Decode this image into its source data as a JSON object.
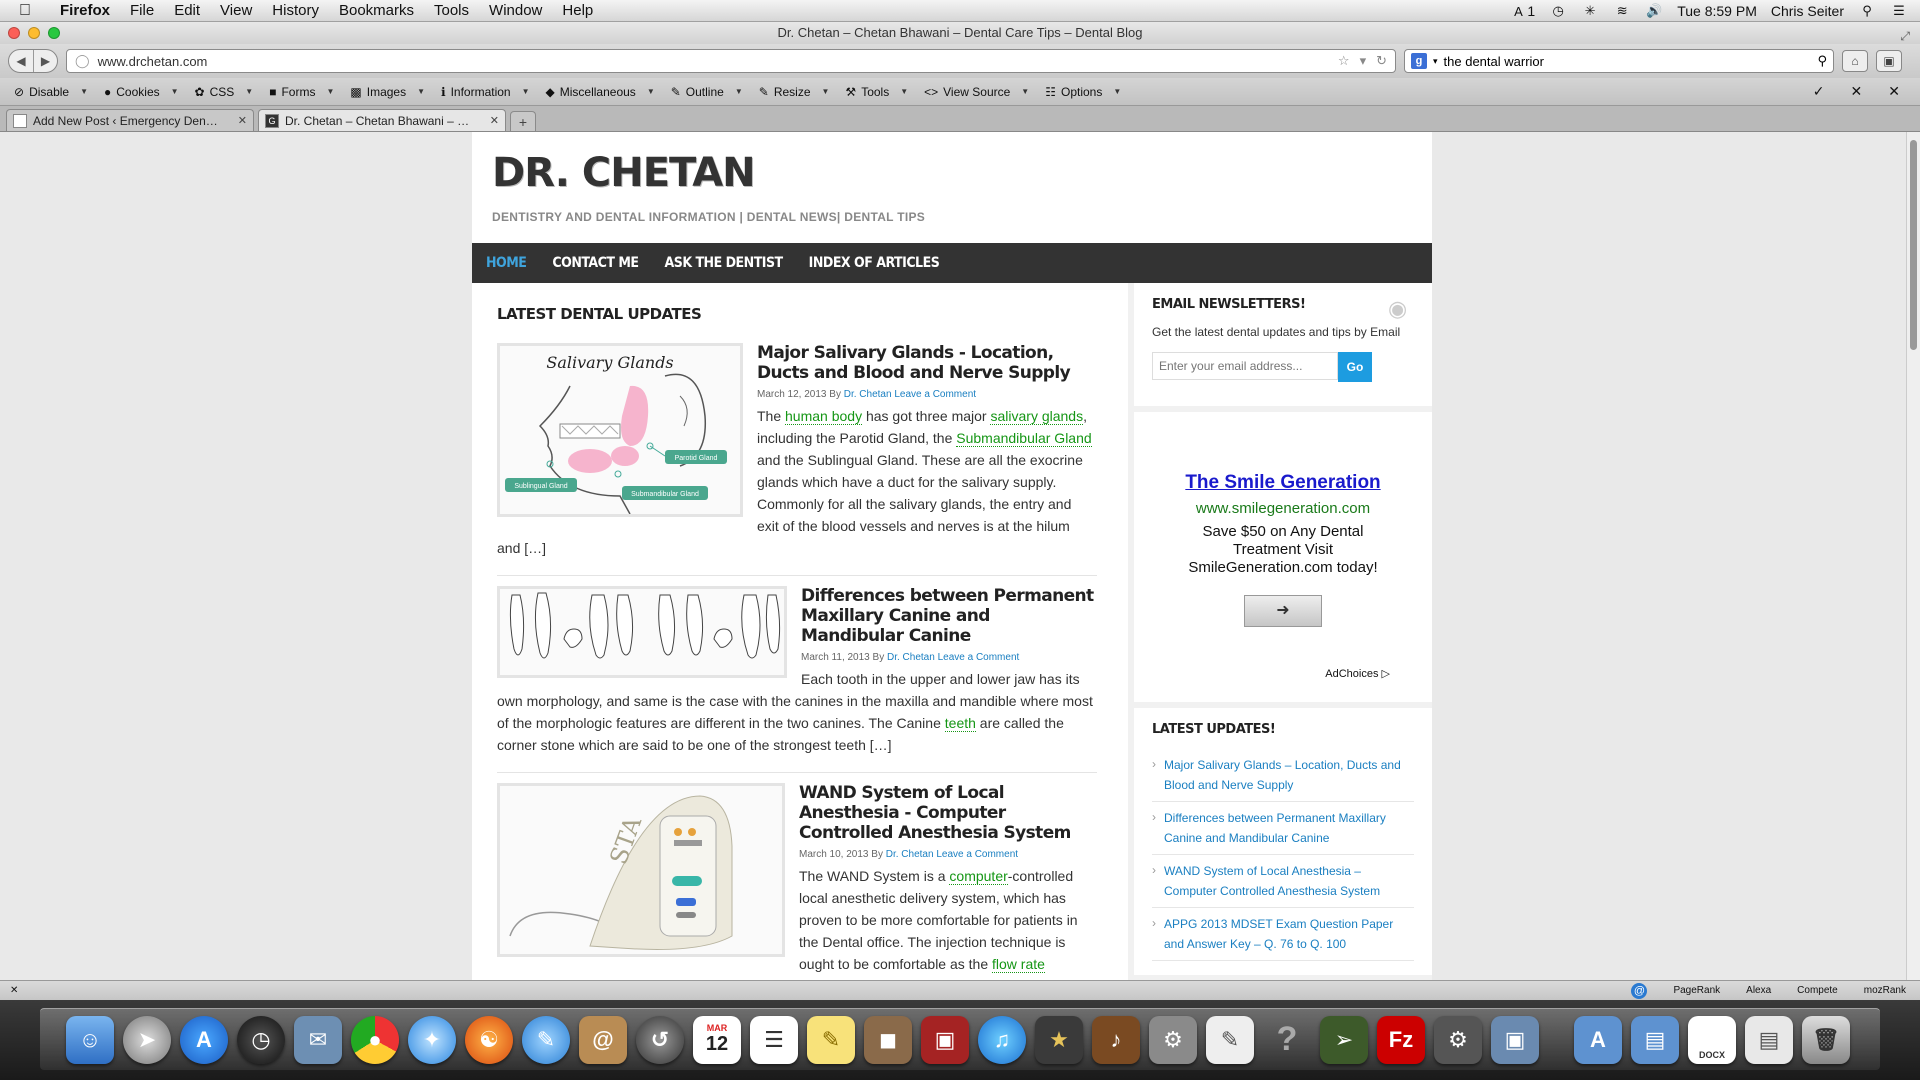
{
  "menubar": {
    "app": "Firefox",
    "items": [
      "File",
      "Edit",
      "View",
      "History",
      "Bookmarks",
      "Tools",
      "Window",
      "Help"
    ],
    "status_badge": "1",
    "clock": "Tue 8:59 PM",
    "user": "Chris Seiter"
  },
  "window": {
    "title": "Dr. Chetan – Chetan Bhawani – Dental Care Tips – Dental Blog"
  },
  "navbar": {
    "url": "www.drchetan.com",
    "search_value": "the dental warrior"
  },
  "devbar": {
    "items": [
      "Disable",
      "Cookies",
      "CSS",
      "Forms",
      "Images",
      "Information",
      "Miscellaneous",
      "Outline",
      "Resize",
      "Tools",
      "View Source",
      "Options"
    ]
  },
  "tabs": [
    {
      "title": "Add New Post ‹ Emergency Den…"
    },
    {
      "title": "Dr. Chetan – Chetan Bhawani – …"
    }
  ],
  "site": {
    "logo": "DR. CHETAN",
    "tagline": "DENTISTRY AND DENTAL INFORMATION | DENTAL NEWS| DENTAL TIPS",
    "nav": [
      "HOME",
      "CONTACT ME",
      "ASK THE DENTIST",
      "INDEX OF ARTICLES"
    ]
  },
  "main": {
    "heading": "LATEST DENTAL UPDATES",
    "posts": [
      {
        "title": "Major Salivary Glands - Location, Ducts and Blood and Nerve Supply",
        "date": "March 12, 2013",
        "by": "By",
        "author": "Dr. Chetan",
        "comment": "Leave a Comment",
        "thumb_title": "Salivary Glands",
        "thumb_labels": [
          "Parotid Gland",
          "Sublingual Gland",
          "Submandibular Gland"
        ],
        "excerpt": {
          "t1": "The ",
          "k1": "human body",
          "t2": " has got three major ",
          "k2": "salivary glands",
          "t3": ", including the Parotid Gland, the ",
          "k3": "Submandibular Gland",
          "t4": " and the Sublingual Gland. These are all the exocrine glands which have a duct for the salivary supply. Commonly for all the salivary glands, the entry and exit of the blood vessels and nerves is at the hilum and […]"
        }
      },
      {
        "title": "Differences between Permanent Maxillary Canine and Mandibular Canine",
        "date": "March 11, 2013",
        "by": "By",
        "author": "Dr. Chetan",
        "comment": "Leave a Comment",
        "excerpt": {
          "t1": "Each tooth in the upper and lower jaw has its own morphology, and same is the case with the canines in the maxilla and mandible where most of the morphologic features are different in the two canines. The Canine ",
          "k1": "teeth",
          "t2": " are called the corner stone which are said to be one of the strongest teeth […]"
        }
      },
      {
        "title": "WAND System of Local Anesthesia - Computer Controlled Anesthesia System",
        "date": "March 10, 2013",
        "by": "By",
        "author": "Dr. Chetan",
        "comment": "Leave a Comment",
        "thumb_label": "STA",
        "excerpt": {
          "t1": "The WAND System is a ",
          "k1": "computer",
          "t2": "-controlled local anesthetic delivery system, which has proven to be more comfortable for patients in the Dental office. The injection technique is ought to be comfortable as the ",
          "k2": "flow rate"
        }
      }
    ]
  },
  "sidebar": {
    "newsletter": {
      "title": "EMAIL NEWSLETTERS!",
      "text": "Get the latest dental updates and tips by Email",
      "placeholder": "Enter your email address...",
      "button": "Go"
    },
    "ad": {
      "title": "The Smile Generation",
      "url": "www.smilegeneration.com",
      "text": "Save $50 on Any Dental Treatment Visit SmileGeneration.com today!",
      "choices": "AdChoices"
    },
    "updates": {
      "title": "LATEST UPDATES!",
      "items": [
        "Major Salivary Glands – Location, Ducts and Blood and Nerve Supply",
        "Differences between Permanent Maxillary Canine and Mandibular Canine",
        "WAND System of Local Anesthesia – Computer Controlled Anesthesia System",
        "APPG 2013 MDSET Exam Question Paper and Answer Key – Q. 76 to Q. 100"
      ]
    }
  },
  "statusbar": {
    "items": [
      "PageRank",
      "Alexa",
      "Compete",
      "mozRank"
    ]
  },
  "dock": {
    "calendar_month": "MAR",
    "calendar_day": "12",
    "docx_label": "DOCX"
  },
  "colors": {
    "accent": "#1d9ce0",
    "nav_bg": "#333333",
    "link_green": "#159615",
    "link_blue": "#1a7fc1"
  }
}
